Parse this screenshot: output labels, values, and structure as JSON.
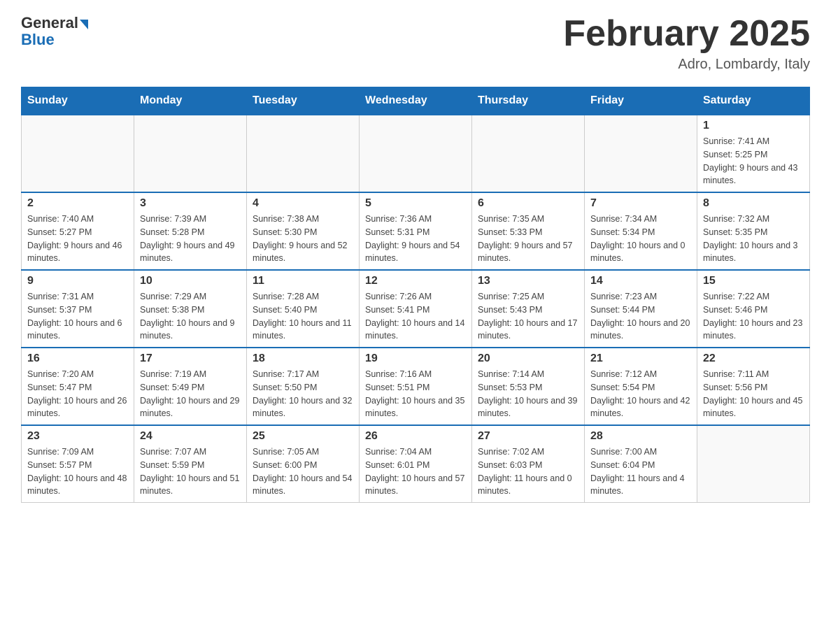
{
  "header": {
    "logo_general": "General",
    "logo_blue": "Blue",
    "month_title": "February 2025",
    "location": "Adro, Lombardy, Italy"
  },
  "days_of_week": [
    "Sunday",
    "Monday",
    "Tuesday",
    "Wednesday",
    "Thursday",
    "Friday",
    "Saturday"
  ],
  "weeks": [
    [
      {
        "day": "",
        "info": ""
      },
      {
        "day": "",
        "info": ""
      },
      {
        "day": "",
        "info": ""
      },
      {
        "day": "",
        "info": ""
      },
      {
        "day": "",
        "info": ""
      },
      {
        "day": "",
        "info": ""
      },
      {
        "day": "1",
        "info": "Sunrise: 7:41 AM\nSunset: 5:25 PM\nDaylight: 9 hours and 43 minutes."
      }
    ],
    [
      {
        "day": "2",
        "info": "Sunrise: 7:40 AM\nSunset: 5:27 PM\nDaylight: 9 hours and 46 minutes."
      },
      {
        "day": "3",
        "info": "Sunrise: 7:39 AM\nSunset: 5:28 PM\nDaylight: 9 hours and 49 minutes."
      },
      {
        "day": "4",
        "info": "Sunrise: 7:38 AM\nSunset: 5:30 PM\nDaylight: 9 hours and 52 minutes."
      },
      {
        "day": "5",
        "info": "Sunrise: 7:36 AM\nSunset: 5:31 PM\nDaylight: 9 hours and 54 minutes."
      },
      {
        "day": "6",
        "info": "Sunrise: 7:35 AM\nSunset: 5:33 PM\nDaylight: 9 hours and 57 minutes."
      },
      {
        "day": "7",
        "info": "Sunrise: 7:34 AM\nSunset: 5:34 PM\nDaylight: 10 hours and 0 minutes."
      },
      {
        "day": "8",
        "info": "Sunrise: 7:32 AM\nSunset: 5:35 PM\nDaylight: 10 hours and 3 minutes."
      }
    ],
    [
      {
        "day": "9",
        "info": "Sunrise: 7:31 AM\nSunset: 5:37 PM\nDaylight: 10 hours and 6 minutes."
      },
      {
        "day": "10",
        "info": "Sunrise: 7:29 AM\nSunset: 5:38 PM\nDaylight: 10 hours and 9 minutes."
      },
      {
        "day": "11",
        "info": "Sunrise: 7:28 AM\nSunset: 5:40 PM\nDaylight: 10 hours and 11 minutes."
      },
      {
        "day": "12",
        "info": "Sunrise: 7:26 AM\nSunset: 5:41 PM\nDaylight: 10 hours and 14 minutes."
      },
      {
        "day": "13",
        "info": "Sunrise: 7:25 AM\nSunset: 5:43 PM\nDaylight: 10 hours and 17 minutes."
      },
      {
        "day": "14",
        "info": "Sunrise: 7:23 AM\nSunset: 5:44 PM\nDaylight: 10 hours and 20 minutes."
      },
      {
        "day": "15",
        "info": "Sunrise: 7:22 AM\nSunset: 5:46 PM\nDaylight: 10 hours and 23 minutes."
      }
    ],
    [
      {
        "day": "16",
        "info": "Sunrise: 7:20 AM\nSunset: 5:47 PM\nDaylight: 10 hours and 26 minutes."
      },
      {
        "day": "17",
        "info": "Sunrise: 7:19 AM\nSunset: 5:49 PM\nDaylight: 10 hours and 29 minutes."
      },
      {
        "day": "18",
        "info": "Sunrise: 7:17 AM\nSunset: 5:50 PM\nDaylight: 10 hours and 32 minutes."
      },
      {
        "day": "19",
        "info": "Sunrise: 7:16 AM\nSunset: 5:51 PM\nDaylight: 10 hours and 35 minutes."
      },
      {
        "day": "20",
        "info": "Sunrise: 7:14 AM\nSunset: 5:53 PM\nDaylight: 10 hours and 39 minutes."
      },
      {
        "day": "21",
        "info": "Sunrise: 7:12 AM\nSunset: 5:54 PM\nDaylight: 10 hours and 42 minutes."
      },
      {
        "day": "22",
        "info": "Sunrise: 7:11 AM\nSunset: 5:56 PM\nDaylight: 10 hours and 45 minutes."
      }
    ],
    [
      {
        "day": "23",
        "info": "Sunrise: 7:09 AM\nSunset: 5:57 PM\nDaylight: 10 hours and 48 minutes."
      },
      {
        "day": "24",
        "info": "Sunrise: 7:07 AM\nSunset: 5:59 PM\nDaylight: 10 hours and 51 minutes."
      },
      {
        "day": "25",
        "info": "Sunrise: 7:05 AM\nSunset: 6:00 PM\nDaylight: 10 hours and 54 minutes."
      },
      {
        "day": "26",
        "info": "Sunrise: 7:04 AM\nSunset: 6:01 PM\nDaylight: 10 hours and 57 minutes."
      },
      {
        "day": "27",
        "info": "Sunrise: 7:02 AM\nSunset: 6:03 PM\nDaylight: 11 hours and 0 minutes."
      },
      {
        "day": "28",
        "info": "Sunrise: 7:00 AM\nSunset: 6:04 PM\nDaylight: 11 hours and 4 minutes."
      },
      {
        "day": "",
        "info": ""
      }
    ]
  ]
}
